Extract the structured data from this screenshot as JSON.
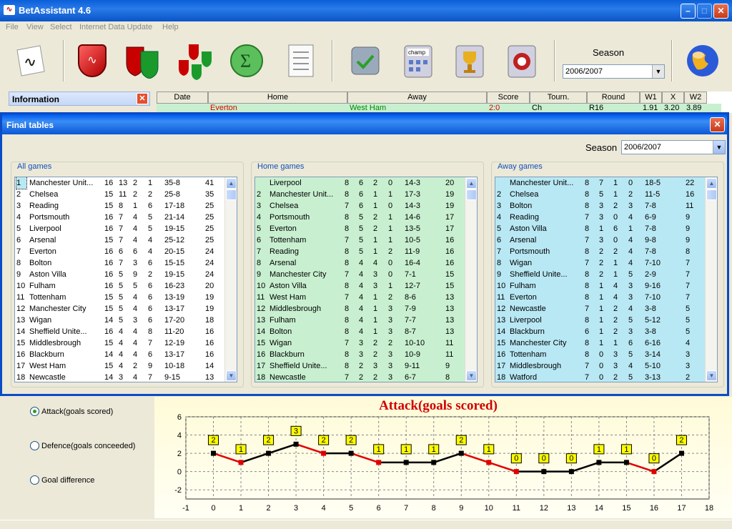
{
  "app": {
    "title": "BetAssistant 4.6"
  },
  "menu": [
    "File",
    "View",
    "Select",
    "Internet Data Update",
    "Help"
  ],
  "toolbar": {
    "season_label": "Season",
    "season_value": "2006/2007",
    "icons": [
      "notepad-icon",
      "red-shield-icon",
      "red-green-shields-icon",
      "clover-shields-icon",
      "sum-icon",
      "list-icon",
      "check-icon",
      "champ-calendar-icon",
      "trophy-icon",
      "uefa-icon",
      "globe-icon"
    ],
    "champ_text": "champ"
  },
  "info_panel": {
    "title": "Information"
  },
  "top_table": {
    "headers": [
      "Date",
      "Home",
      "Away",
      "Score",
      "Tourn.",
      "Round",
      "W1",
      "X",
      "W2"
    ],
    "row": {
      "home": "Everton",
      "away": "West Ham",
      "score": "2:0",
      "tourn": "Ch",
      "round": "R16",
      "w1": "1.91",
      "x": "3.20",
      "w2": "3.89"
    }
  },
  "dialog": {
    "title": "Final tables",
    "season_label": "Season",
    "season_value": "2006/2007",
    "all_games": {
      "label": "All games",
      "rows": [
        [
          "1",
          "Manchester Unit...",
          "16",
          "13",
          "2",
          "1",
          "35-8",
          "41"
        ],
        [
          "2",
          "Chelsea",
          "15",
          "11",
          "2",
          "2",
          "25-8",
          "35"
        ],
        [
          "3",
          "Reading",
          "15",
          "8",
          "1",
          "6",
          "17-18",
          "25"
        ],
        [
          "4",
          "Portsmouth",
          "16",
          "7",
          "4",
          "5",
          "21-14",
          "25"
        ],
        [
          "5",
          "Liverpool",
          "16",
          "7",
          "4",
          "5",
          "19-15",
          "25"
        ],
        [
          "6",
          "Arsenal",
          "15",
          "7",
          "4",
          "4",
          "25-12",
          "25"
        ],
        [
          "7",
          "Everton",
          "16",
          "6",
          "6",
          "4",
          "20-15",
          "24"
        ],
        [
          "8",
          "Bolton",
          "16",
          "7",
          "3",
          "6",
          "15-15",
          "24"
        ],
        [
          "9",
          "Aston Villa",
          "16",
          "5",
          "9",
          "2",
          "19-15",
          "24"
        ],
        [
          "10",
          "Fulham",
          "16",
          "5",
          "5",
          "6",
          "16-23",
          "20"
        ],
        [
          "11",
          "Tottenham",
          "15",
          "5",
          "4",
          "6",
          "13-19",
          "19"
        ],
        [
          "12",
          "Manchester City",
          "15",
          "5",
          "4",
          "6",
          "13-17",
          "19"
        ],
        [
          "13",
          "Wigan",
          "14",
          "5",
          "3",
          "6",
          "17-20",
          "18"
        ],
        [
          "14",
          "Sheffield Unite...",
          "16",
          "4",
          "4",
          "8",
          "11-20",
          "16"
        ],
        [
          "15",
          "Middlesbrough",
          "15",
          "4",
          "4",
          "7",
          "12-19",
          "16"
        ],
        [
          "16",
          "Blackburn",
          "14",
          "4",
          "4",
          "6",
          "13-17",
          "16"
        ],
        [
          "17",
          "West Ham",
          "15",
          "4",
          "2",
          "9",
          "10-18",
          "14"
        ],
        [
          "18",
          "Newcastle",
          "14",
          "3",
          "4",
          "7",
          "9-15",
          "13"
        ]
      ]
    },
    "home_games": {
      "label": "Home games",
      "rows": [
        [
          "",
          "Liverpool",
          "8",
          "6",
          "2",
          "0",
          "14-3",
          "20"
        ],
        [
          "2",
          "Manchester Unit...",
          "8",
          "6",
          "1",
          "1",
          "17-3",
          "19"
        ],
        [
          "3",
          "Chelsea",
          "7",
          "6",
          "1",
          "0",
          "14-3",
          "19"
        ],
        [
          "4",
          "Portsmouth",
          "8",
          "5",
          "2",
          "1",
          "14-6",
          "17"
        ],
        [
          "5",
          "Everton",
          "8",
          "5",
          "2",
          "1",
          "13-5",
          "17"
        ],
        [
          "6",
          "Tottenham",
          "7",
          "5",
          "1",
          "1",
          "10-5",
          "16"
        ],
        [
          "7",
          "Reading",
          "8",
          "5",
          "1",
          "2",
          "11-9",
          "16"
        ],
        [
          "8",
          "Arsenal",
          "8",
          "4",
          "4",
          "0",
          "16-4",
          "16"
        ],
        [
          "9",
          "Manchester City",
          "7",
          "4",
          "3",
          "0",
          "7-1",
          "15"
        ],
        [
          "10",
          "Aston Villa",
          "8",
          "4",
          "3",
          "1",
          "12-7",
          "15"
        ],
        [
          "11",
          "West Ham",
          "7",
          "4",
          "1",
          "2",
          "8-6",
          "13"
        ],
        [
          "12",
          "Middlesbrough",
          "8",
          "4",
          "1",
          "3",
          "7-9",
          "13"
        ],
        [
          "13",
          "Fulham",
          "8",
          "4",
          "1",
          "3",
          "7-7",
          "13"
        ],
        [
          "14",
          "Bolton",
          "8",
          "4",
          "1",
          "3",
          "8-7",
          "13"
        ],
        [
          "15",
          "Wigan",
          "7",
          "3",
          "2",
          "2",
          "10-10",
          "11"
        ],
        [
          "16",
          "Blackburn",
          "8",
          "3",
          "2",
          "3",
          "10-9",
          "11"
        ],
        [
          "17",
          "Sheffield Unite...",
          "8",
          "2",
          "3",
          "3",
          "9-11",
          "9"
        ],
        [
          "18",
          "Newcastle",
          "7",
          "2",
          "2",
          "3",
          "6-7",
          "8"
        ]
      ]
    },
    "away_games": {
      "label": "Away games",
      "rows": [
        [
          "",
          "Manchester Unit...",
          "8",
          "7",
          "1",
          "0",
          "18-5",
          "22"
        ],
        [
          "2",
          "Chelsea",
          "8",
          "5",
          "1",
          "2",
          "11-5",
          "16"
        ],
        [
          "3",
          "Bolton",
          "8",
          "3",
          "2",
          "3",
          "7-8",
          "11"
        ],
        [
          "4",
          "Reading",
          "7",
          "3",
          "0",
          "4",
          "6-9",
          "9"
        ],
        [
          "5",
          "Aston Villa",
          "8",
          "1",
          "6",
          "1",
          "7-8",
          "9"
        ],
        [
          "6",
          "Arsenal",
          "7",
          "3",
          "0",
          "4",
          "9-8",
          "9"
        ],
        [
          "7",
          "Portsmouth",
          "8",
          "2",
          "2",
          "4",
          "7-8",
          "8"
        ],
        [
          "8",
          "Wigan",
          "7",
          "2",
          "1",
          "4",
          "7-10",
          "7"
        ],
        [
          "9",
          "Sheffield Unite...",
          "8",
          "2",
          "1",
          "5",
          "2-9",
          "7"
        ],
        [
          "10",
          "Fulham",
          "8",
          "1",
          "4",
          "3",
          "9-16",
          "7"
        ],
        [
          "11",
          "Everton",
          "8",
          "1",
          "4",
          "3",
          "7-10",
          "7"
        ],
        [
          "12",
          "Newcastle",
          "7",
          "1",
          "2",
          "4",
          "3-8",
          "5"
        ],
        [
          "13",
          "Liverpool",
          "8",
          "1",
          "2",
          "5",
          "5-12",
          "5"
        ],
        [
          "14",
          "Blackburn",
          "6",
          "1",
          "2",
          "3",
          "3-8",
          "5"
        ],
        [
          "15",
          "Manchester City",
          "8",
          "1",
          "1",
          "6",
          "6-16",
          "4"
        ],
        [
          "16",
          "Tottenham",
          "8",
          "0",
          "3",
          "5",
          "3-14",
          "3"
        ],
        [
          "17",
          "Middlesbrough",
          "7",
          "0",
          "3",
          "4",
          "5-10",
          "3"
        ],
        [
          "18",
          "Watford",
          "7",
          "0",
          "2",
          "5",
          "3-13",
          "2"
        ]
      ]
    }
  },
  "radios": {
    "attack": "Attack(goals scored)",
    "defence": "Defence(goals conceeded)",
    "diff": "Goal difference",
    "selected": "attack"
  },
  "colors": {
    "up": "#000000",
    "down": "#e00000",
    "label_bg": "#ffff00",
    "title": "#d00000"
  },
  "chart_data": {
    "type": "line",
    "title": "Attack(goals scored)",
    "x": [
      0,
      1,
      2,
      3,
      4,
      5,
      6,
      7,
      8,
      9,
      10,
      11,
      12,
      13,
      14,
      15,
      16,
      17
    ],
    "values": [
      2,
      1,
      2,
      3,
      2,
      2,
      1,
      1,
      1,
      2,
      1,
      0,
      0,
      0,
      1,
      1,
      0,
      2
    ],
    "xlim": [
      -1,
      18
    ],
    "ylim": [
      -3,
      6
    ],
    "xticks": [
      -1,
      0,
      1,
      2,
      3,
      4,
      5,
      6,
      7,
      8,
      9,
      10,
      11,
      12,
      13,
      14,
      15,
      16,
      17,
      18
    ],
    "yticks": [
      -2,
      0,
      2,
      4,
      6
    ],
    "grid": true,
    "segment_colors": [
      "down",
      "up",
      "up",
      "down",
      "same",
      "down",
      "same",
      "same",
      "up",
      "down",
      "down",
      "same",
      "same",
      "up",
      "same",
      "down",
      "up"
    ]
  }
}
